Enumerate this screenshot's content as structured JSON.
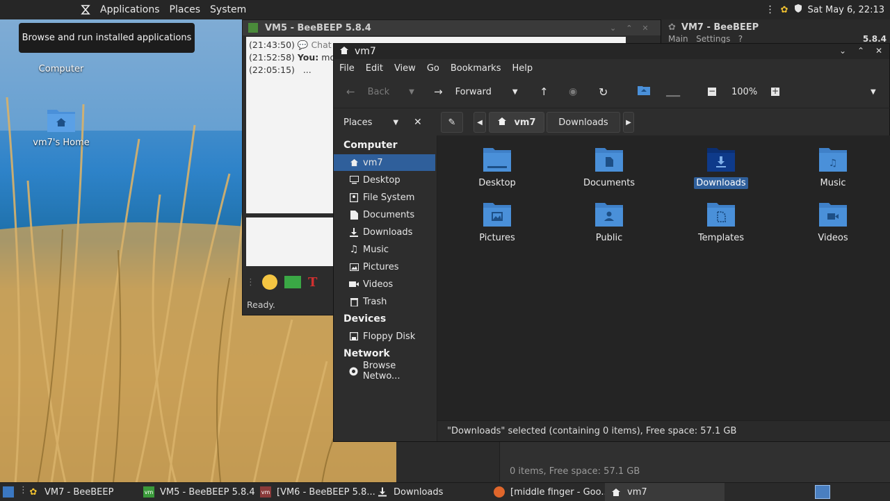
{
  "top_panel": {
    "menus": [
      "Applications",
      "Places",
      "System"
    ],
    "clock": "Sat May 6, 22:13"
  },
  "tooltip": "Browse and run installed applications",
  "desktop_icons": [
    {
      "label": "Computer",
      "icon": "computer-icon"
    },
    {
      "label": "vm7's Home",
      "icon": "home-folder-icon"
    }
  ],
  "vm5_window": {
    "title": "VM5 - BeeBEEP 5.8.4",
    "chat": [
      {
        "time": "(21:43:50)",
        "speaker": "",
        "text": "Chat w"
      },
      {
        "time": "(21:52:58)",
        "speaker": "You:",
        "text": "mon"
      },
      {
        "time": "(22:05:15)",
        "speaker": "",
        "text": "..."
      }
    ],
    "status": "Ready."
  },
  "vm7_beebeep_window": {
    "title": "VM7 - BeeBEEP",
    "menus": [
      "Main",
      "Settings",
      "?"
    ],
    "version": "5.8.4"
  },
  "background_status": "0 items, Free space: 57.1 GB",
  "file_manager": {
    "title": "vm7",
    "menus": [
      "File",
      "Edit",
      "View",
      "Go",
      "Bookmarks",
      "Help"
    ],
    "toolbar": {
      "back": "Back",
      "forward": "Forward",
      "zoom": "100%"
    },
    "places_label": "Places",
    "breadcrumbs": [
      "vm7",
      "Downloads"
    ],
    "sidebar": {
      "computer_heading": "Computer",
      "computer_items": [
        {
          "label": "vm7",
          "icon": "home-icon",
          "selected": true
        },
        {
          "label": "Desktop",
          "icon": "desktop-icon",
          "selected": false
        },
        {
          "label": "File System",
          "icon": "drive-icon",
          "selected": false
        },
        {
          "label": "Documents",
          "icon": "document-icon",
          "selected": false
        },
        {
          "label": "Downloads",
          "icon": "download-icon",
          "selected": false
        },
        {
          "label": "Music",
          "icon": "music-icon",
          "selected": false
        },
        {
          "label": "Pictures",
          "icon": "picture-icon",
          "selected": false
        },
        {
          "label": "Videos",
          "icon": "video-icon",
          "selected": false
        },
        {
          "label": "Trash",
          "icon": "trash-icon",
          "selected": false
        }
      ],
      "devices_heading": "Devices",
      "device_items": [
        {
          "label": "Floppy Disk",
          "icon": "floppy-icon"
        }
      ],
      "network_heading": "Network",
      "network_items": [
        {
          "label": "Browse Netwo...",
          "icon": "network-icon"
        }
      ]
    },
    "folders": [
      {
        "label": "Desktop",
        "glyph": "desktop",
        "selected": false
      },
      {
        "label": "Documents",
        "glyph": "document",
        "selected": false
      },
      {
        "label": "Downloads",
        "glyph": "download",
        "selected": true
      },
      {
        "label": "Music",
        "glyph": "music",
        "selected": false
      },
      {
        "label": "Pictures",
        "glyph": "picture",
        "selected": false
      },
      {
        "label": "Public",
        "glyph": "public",
        "selected": false
      },
      {
        "label": "Templates",
        "glyph": "template",
        "selected": false
      },
      {
        "label": "Videos",
        "glyph": "video",
        "selected": false
      }
    ],
    "status": "\"Downloads\" selected (containing 0 items), Free space: 57.1 GB"
  },
  "taskbar": {
    "tasks": [
      {
        "label": "VM7 - BeeBEEP",
        "icon": "beebeep-icon"
      },
      {
        "label": "VM5 - BeeBEEP 5.8.4",
        "icon": "vm-icon"
      },
      {
        "label": "[VM6 - BeeBEEP 5.8...",
        "icon": "vm-red-icon"
      },
      {
        "label": "Downloads",
        "icon": "download-icon"
      },
      {
        "label": "[middle finger - Goo...",
        "icon": "firefox-icon"
      },
      {
        "label": "vm7",
        "icon": "home-icon"
      }
    ]
  },
  "colors": {
    "panel": "#262626",
    "selection": "#2f5f9b",
    "folder": "#4a90d9",
    "folder_selected": "#0e3a8a"
  }
}
